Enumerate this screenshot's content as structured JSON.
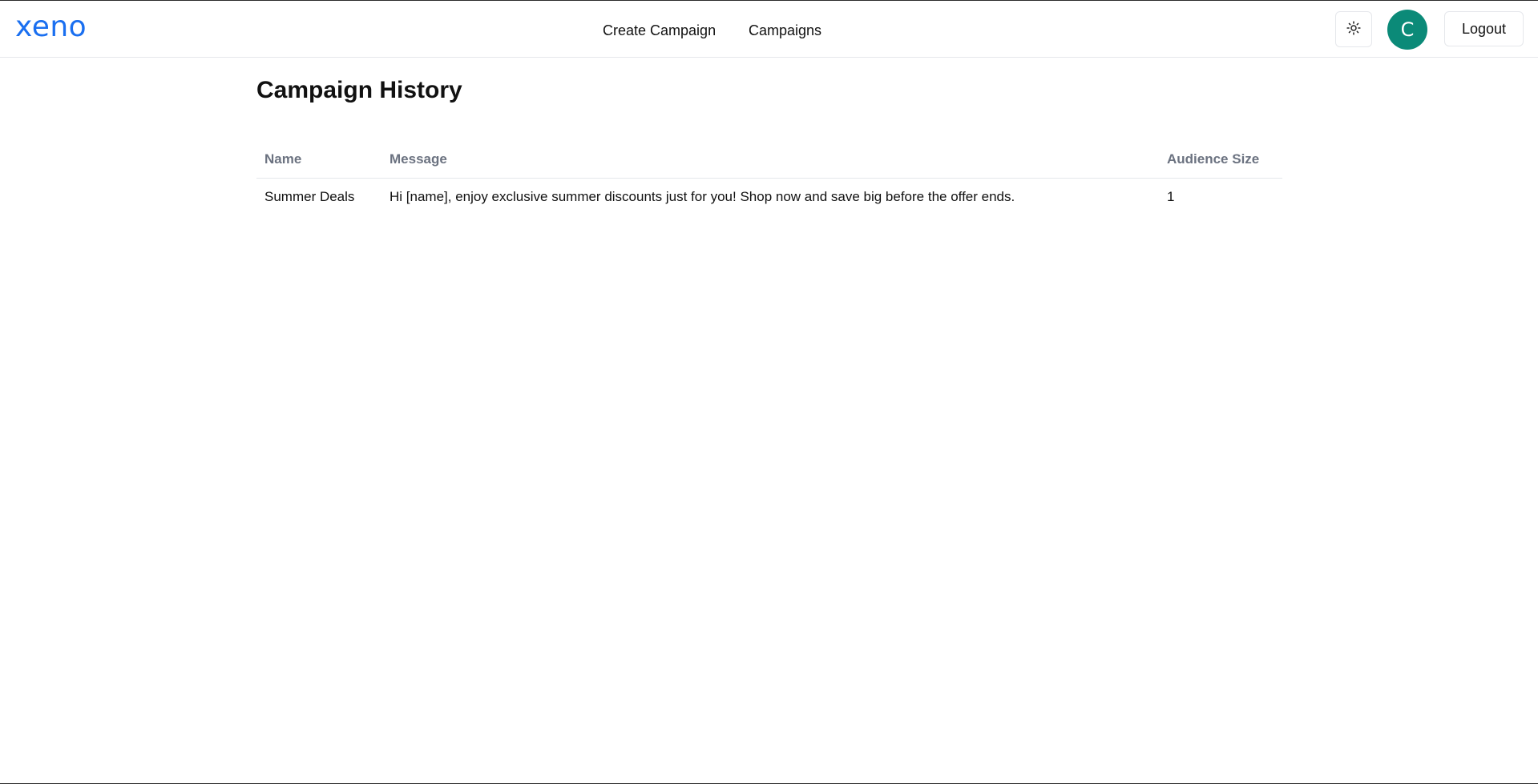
{
  "brand": {
    "logo_text": "xeno",
    "logo_color": "#1a6ff0"
  },
  "nav": {
    "links": [
      {
        "label": "Create Campaign"
      },
      {
        "label": "Campaigns"
      }
    ]
  },
  "header_actions": {
    "theme_toggle_icon": "sun-icon",
    "avatar_initial": "C",
    "avatar_color": "#0b8a78",
    "logout_label": "Logout"
  },
  "page": {
    "title": "Campaign History"
  },
  "table": {
    "columns": [
      "Name",
      "Message",
      "Audience Size"
    ],
    "rows": [
      {
        "name": "Summer Deals",
        "message": "Hi [name], enjoy exclusive summer discounts just for you! Shop now and save big before the offer ends.",
        "audience_size": "1"
      }
    ]
  }
}
